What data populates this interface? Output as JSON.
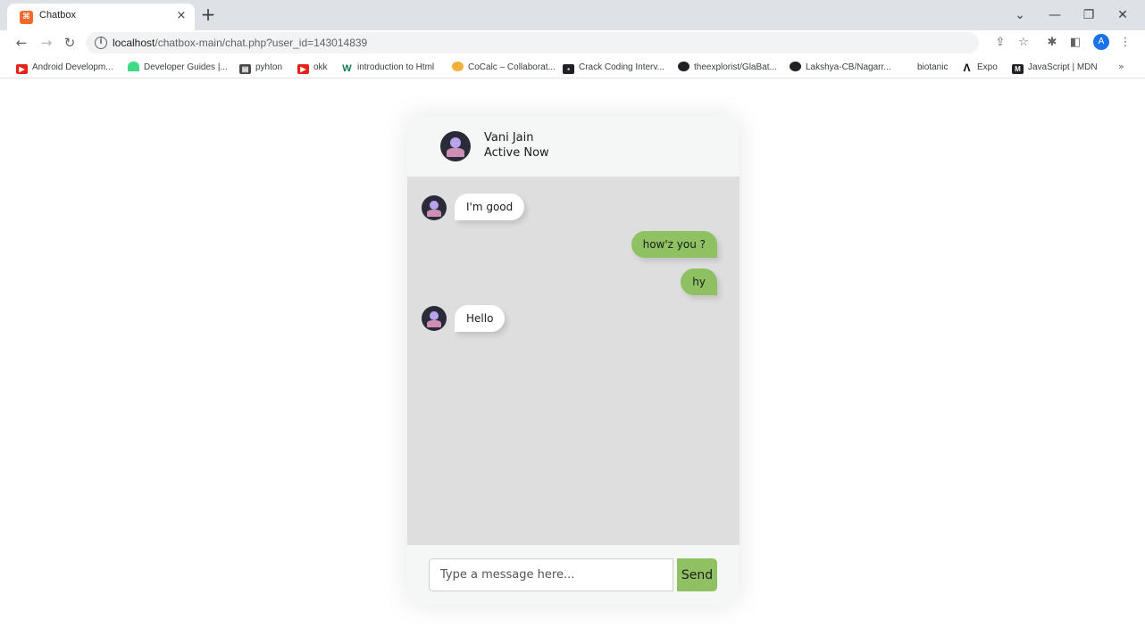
{
  "browser": {
    "tab_title": "Chatbox",
    "tab_close": "×",
    "new_tab": "+",
    "url_host": "localhost",
    "url_path": "/chatbox-main/chat.php?user_id=143014839",
    "profile_initial": "A",
    "bookmarks": [
      {
        "label": "Android Developm...",
        "icon": "youtube-icon"
      },
      {
        "label": "Developer Guides |...",
        "icon": "android-icon"
      },
      {
        "label": "pyhton",
        "icon": "book-icon"
      },
      {
        "label": "okk",
        "icon": "youtube-icon"
      },
      {
        "label": "introduction to Html",
        "icon": "w3schools-icon"
      },
      {
        "label": "CoCalc – Collaborat...",
        "icon": "cocalc-icon"
      },
      {
        "label": "Crack Coding Interv...",
        "icon": "codechef-icon"
      },
      {
        "label": "theexplorist/GlaBat...",
        "icon": "github-icon"
      },
      {
        "label": "Lakshya-CB/Nagarr...",
        "icon": "github-icon"
      },
      {
        "label": "biotanic",
        "icon": ""
      },
      {
        "label": "Expo",
        "icon": "expo-icon"
      },
      {
        "label": "JavaScript | MDN",
        "icon": "mdn-icon"
      }
    ]
  },
  "chat": {
    "header": {
      "name": "Vani Jain",
      "status": "Active Now"
    },
    "messages": [
      {
        "direction": "incoming",
        "text": "I'm good"
      },
      {
        "direction": "outgoing",
        "text": "how'z you ?"
      },
      {
        "direction": "outgoing",
        "text": "hy"
      },
      {
        "direction": "incoming",
        "text": "Hello"
      }
    ],
    "input_placeholder": "Type a message here...",
    "input_value": "",
    "send_label": "Send"
  },
  "colors": {
    "outgoing_bubble": "#8fc163",
    "incoming_bubble": "#ffffff",
    "chat_background": "#dedede",
    "panel_background": "#f5f6f6"
  }
}
